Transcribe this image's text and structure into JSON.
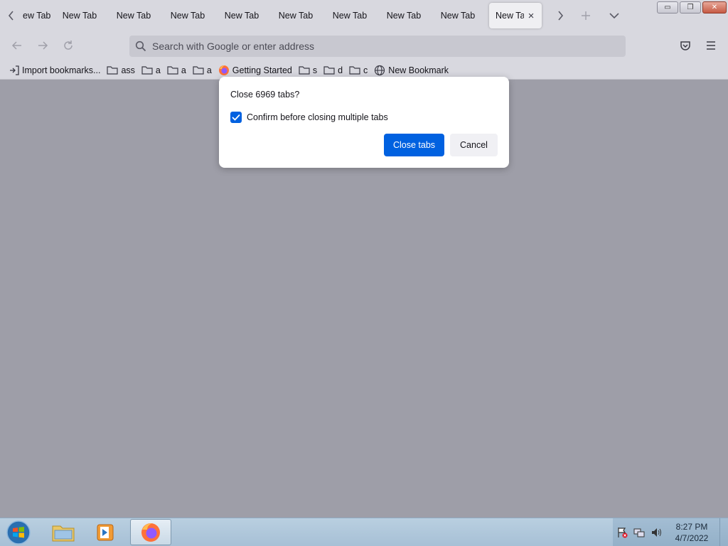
{
  "tabs": {
    "first_partial_label": "ew Tab",
    "labels": [
      "New Tab",
      "New Tab",
      "New Tab",
      "New Tab",
      "New Tab",
      "New Tab",
      "New Tab",
      "New Tab"
    ],
    "active_label": "New Tab"
  },
  "urlbar": {
    "placeholder": "Search with Google or enter address"
  },
  "bookmarks": [
    {
      "label": "Import bookmarks...",
      "icon": "import-icon"
    },
    {
      "label": "ass",
      "icon": "folder-icon"
    },
    {
      "label": "a",
      "icon": "folder-icon"
    },
    {
      "label": "a",
      "icon": "folder-icon"
    },
    {
      "label": "a",
      "icon": "folder-icon"
    },
    {
      "label": "Getting Started",
      "icon": "firefox-icon"
    },
    {
      "label": "s",
      "icon": "folder-icon"
    },
    {
      "label": "d",
      "icon": "folder-icon"
    },
    {
      "label": "c",
      "icon": "folder-icon"
    },
    {
      "label": "New Bookmark",
      "icon": "globe-icon"
    }
  ],
  "dialog": {
    "title": "Close 6969 tabs?",
    "checkbox_label": "Confirm before closing multiple tabs",
    "checkbox_checked": true,
    "primary_button": "Close tabs",
    "secondary_button": "Cancel"
  },
  "taskbar": {
    "time": "8:27 PM",
    "date": "4/7/2022",
    "apps": [
      "file-explorer-icon",
      "media-player-icon",
      "firefox-icon"
    ]
  },
  "colors": {
    "accent": "#0061e0",
    "chrome": "#d8d8df",
    "overlay": "#9e9ea8"
  }
}
